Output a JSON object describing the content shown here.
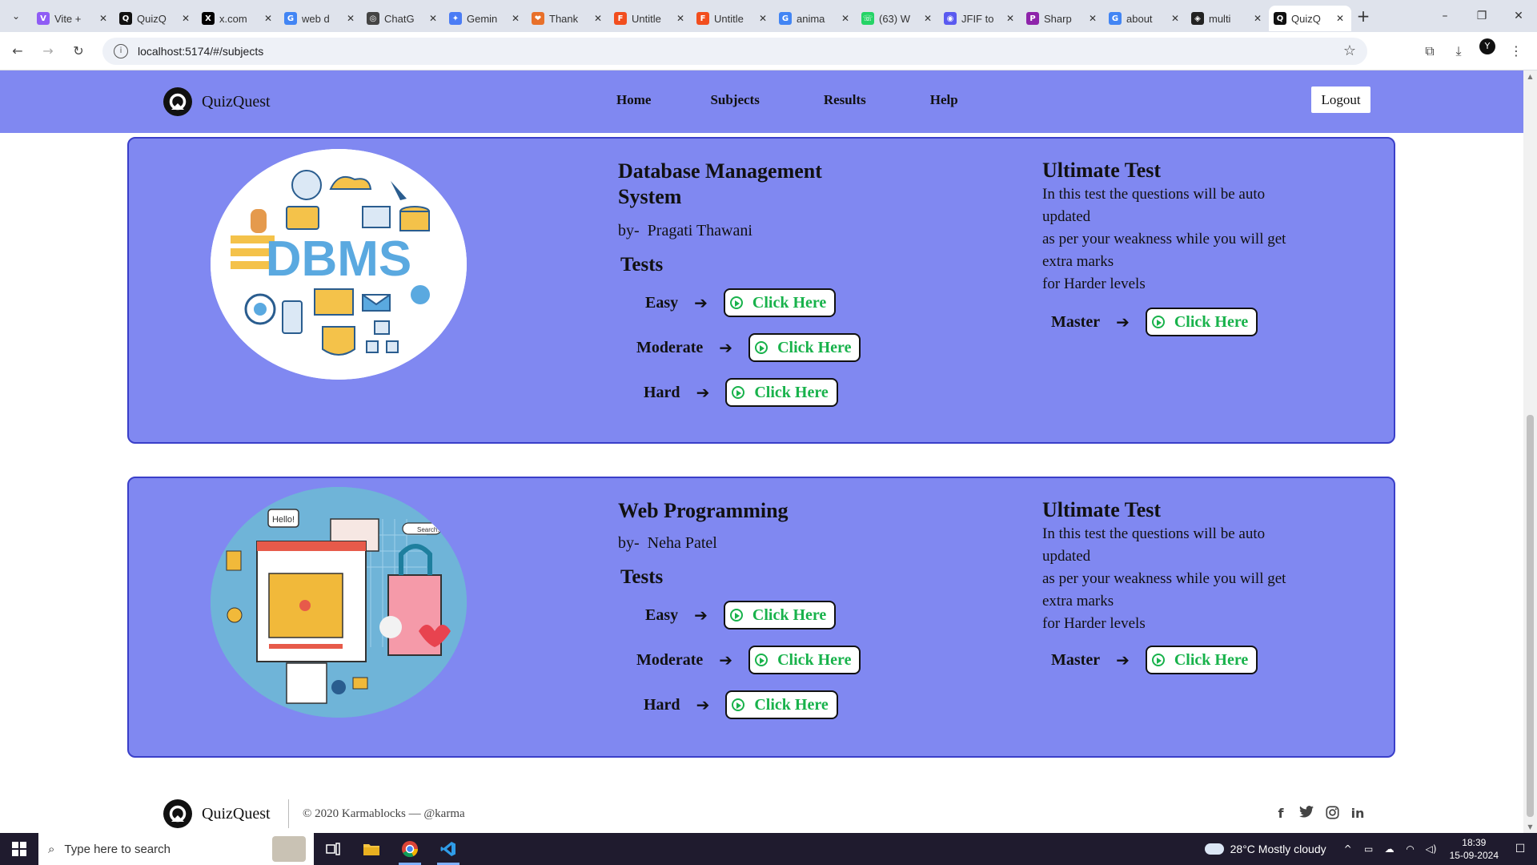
{
  "browser": {
    "tabs": [
      {
        "title": "Vite +",
        "fav_color": "#8f5cf5",
        "fav_glyph": "V",
        "icon": "vite-icon"
      },
      {
        "title": "QuizQ",
        "fav_color": "#111111",
        "fav_glyph": "Q",
        "icon": "quizquest-icon"
      },
      {
        "title": "x.com",
        "fav_color": "#000000",
        "fav_glyph": "X",
        "icon": "x-icon"
      },
      {
        "title": "web d",
        "fav_color": "#4285f4",
        "fav_glyph": "G",
        "icon": "google-icon"
      },
      {
        "title": "ChatG",
        "fav_color": "#444444",
        "fav_glyph": "◎",
        "icon": "chatgpt-icon"
      },
      {
        "title": "Gemin",
        "fav_color": "#4a7cf5",
        "fav_glyph": "✦",
        "icon": "gemini-icon"
      },
      {
        "title": "Thank",
        "fav_color": "#e8702a",
        "fav_glyph": "❤",
        "icon": "thanks-icon"
      },
      {
        "title": "Untitle",
        "fav_color": "#f24e1e",
        "fav_glyph": "F",
        "icon": "figma-icon"
      },
      {
        "title": "Untitle",
        "fav_color": "#f24e1e",
        "fav_glyph": "F",
        "icon": "figma-icon"
      },
      {
        "title": "anima",
        "fav_color": "#4285f4",
        "fav_glyph": "G",
        "icon": "google-icon"
      },
      {
        "title": "(63) W",
        "fav_color": "#25d366",
        "fav_glyph": "☏",
        "icon": "whatsapp-icon"
      },
      {
        "title": "JFIF to",
        "fav_color": "#5a5af0",
        "fav_glyph": "◉",
        "icon": "converter-icon"
      },
      {
        "title": "Sharp",
        "fav_color": "#8e24aa",
        "fav_glyph": "P",
        "icon": "sharp-icon"
      },
      {
        "title": "about",
        "fav_color": "#4285f4",
        "fav_glyph": "G",
        "icon": "google-icon"
      },
      {
        "title": "multi",
        "fav_color": "#222222",
        "fav_glyph": "◈",
        "icon": "openai-icon"
      },
      {
        "title": "QuizQ",
        "fav_color": "#111111",
        "fav_glyph": "Q",
        "icon": "quizquest-icon",
        "active": true
      }
    ],
    "url": "localhost:5174/#/subjects"
  },
  "site": {
    "brand": "QuizQuest",
    "nav": [
      "Home",
      "Subjects",
      "Results",
      "Help"
    ],
    "logout": "Logout"
  },
  "subjects": [
    {
      "title": "Database Management System",
      "by_prefix": "by-",
      "author": "Pragati Thawani",
      "tests_heading": "Tests",
      "levels": [
        "Easy",
        "Moderate",
        "Hard"
      ],
      "button_label": "Click Here",
      "ultimate": {
        "title": "Ultimate Test",
        "lines": [
          "In this test the questions will be auto updated",
          "as per your weakness while you will get extra marks",
          "for Harder levels"
        ],
        "level": "Master",
        "button_label": "Click Here"
      },
      "image_text": "DBMS"
    },
    {
      "title": "Web Programming",
      "by_prefix": "by-",
      "author": "Neha Patel",
      "tests_heading": "Tests",
      "levels": [
        "Easy",
        "Moderate",
        "Hard"
      ],
      "button_label": "Click Here",
      "ultimate": {
        "title": "Ultimate Test",
        "lines": [
          "In this test the questions will be auto updated",
          "as per your weakness while you will get extra marks",
          "for Harder levels"
        ],
        "level": "Master",
        "button_label": "Click Here"
      },
      "image_text": "Hello!",
      "image_search_text": "Search..."
    }
  ],
  "footer": {
    "brand": "QuizQuest",
    "copyright": "© 2020 Karmablocks — @karma",
    "socials": [
      "f",
      "twitter",
      "instagram",
      "in"
    ]
  },
  "taskbar": {
    "search_placeholder": "Type here to search",
    "weather": "28°C  Mostly cloudy",
    "time": "18:39",
    "date": "15-09-2024"
  },
  "colors": {
    "accent": "#8088f1",
    "card_border": "#3a3fc9",
    "button_text": "#18b24b"
  }
}
